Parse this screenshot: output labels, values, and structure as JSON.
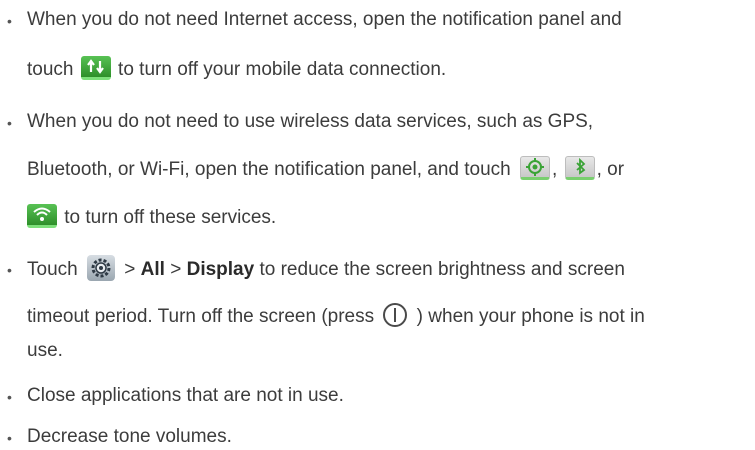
{
  "bullets": [
    {
      "line1": "When you do not need Internet access, open the notification panel and",
      "line2_pre": "touch",
      "line2_post": "to turn off your mobile data connection."
    },
    {
      "line1": "When you do not need to use wireless data services, such as GPS,",
      "line2_pre": "Bluetooth, or Wi-Fi, open the notification panel, and touch",
      "line2_sep1": ",",
      "line2_sep2": ", or",
      "line3_post": "to turn off these services."
    },
    {
      "line1_pre": "Touch",
      "line1_sep1": ">",
      "line1_bold1": "All",
      "line1_sep2": ">",
      "line1_bold2": "Display",
      "line1_post": "to reduce the screen brightness and screen",
      "line2_pre": "timeout period. Turn off the screen (press",
      "line2_post": ") when your phone is not in",
      "line3": "use."
    },
    {
      "line1": "Close applications that are not in use."
    },
    {
      "line1": "Decrease tone volumes."
    }
  ],
  "bullet_char": "•",
  "icons": {
    "data": "mobile-data-icon",
    "gps": "gps-icon",
    "bluetooth": "bluetooth-icon",
    "wifi": "wifi-icon",
    "settings": "settings-icon",
    "power": "power-button-icon"
  },
  "colors": {
    "text": "#3c3c3c",
    "icon_green": "#3aa336"
  }
}
